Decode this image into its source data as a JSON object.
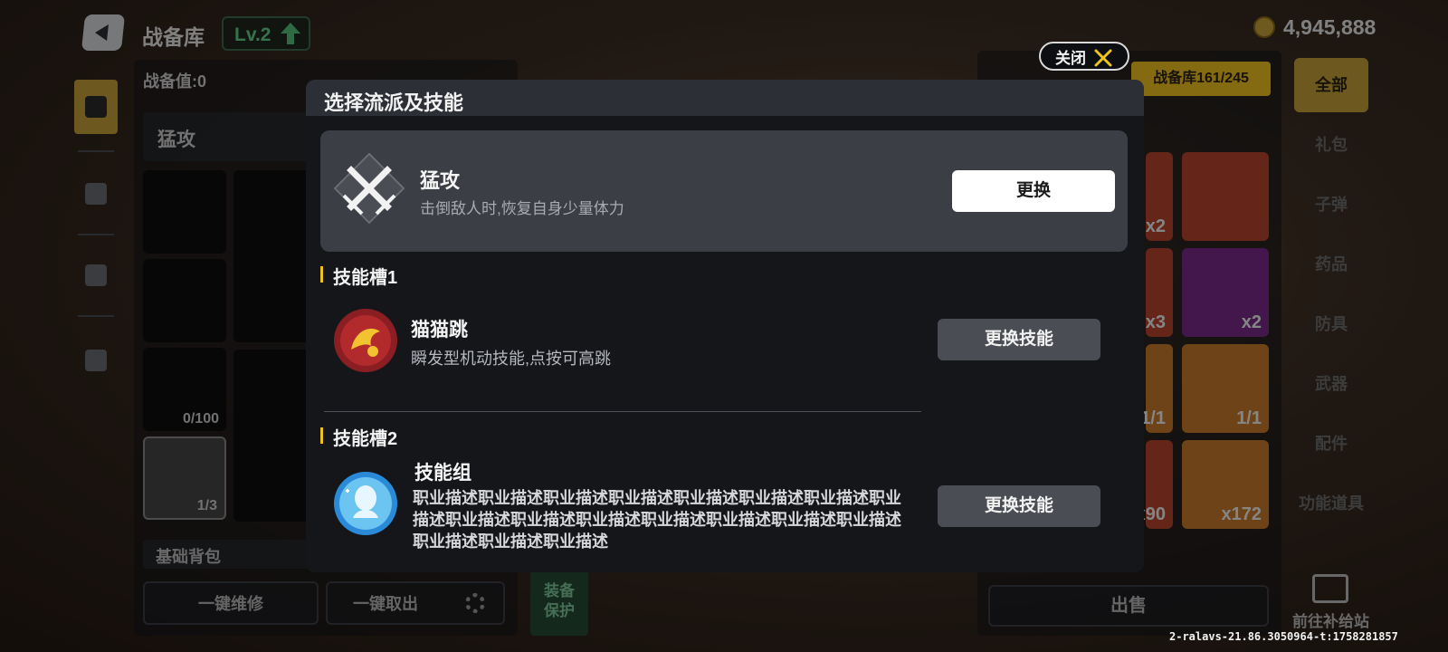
{
  "topbar": {
    "title": "战备库",
    "level": "Lv.2",
    "coins": "4,945,888"
  },
  "left_panel": {
    "stat_label": "战备值:0",
    "build_name": "猛攻",
    "slot_capacity": "0/100",
    "wallet_capacity": "1/3",
    "bag_label": "基础背包",
    "repair_all": "一键维修",
    "take_all": "一键取出",
    "protect_label": "装备\n保护"
  },
  "right_panel": {
    "stash_badge": "战备库161/245",
    "item_counts": [
      "x2",
      "x3",
      "x2",
      "1/1",
      "1/1",
      "x90",
      "x172"
    ],
    "sell_label": "出售",
    "categories": [
      "全部",
      "礼包",
      "子弹",
      "药品",
      "防具",
      "武器",
      "配件",
      "功能道具"
    ],
    "supply_label": "前往补给站"
  },
  "version": "2-ralavs-21.86.3050964-t:1758281857",
  "modal": {
    "close_label": "关闭",
    "title": "选择流派及技能",
    "school": {
      "name": "猛攻",
      "description": "击倒敌人时,恢复自身少量体力",
      "button": "更换"
    },
    "slots": [
      {
        "title": "技能槽1",
        "skill_name": "猫猫跳",
        "skill_desc": "瞬发型机动技能,点按可高跳",
        "button": "更换技能"
      },
      {
        "title": "技能槽2",
        "skill_name": "技能组",
        "skill_desc": "职业描述职业描述职业描述职业描述职业描述职业描述职业描述职业描述职业描述职业描述职业描述职业描述职业描述职业描述职业描述职业描述职业描述职业描述",
        "button": "更换技能"
      }
    ]
  },
  "colors": {
    "accent_gold": "#f0c21e",
    "modal_bg": "#14161a",
    "card_bg": "#3b3e45",
    "level_green": "#66d08a"
  }
}
